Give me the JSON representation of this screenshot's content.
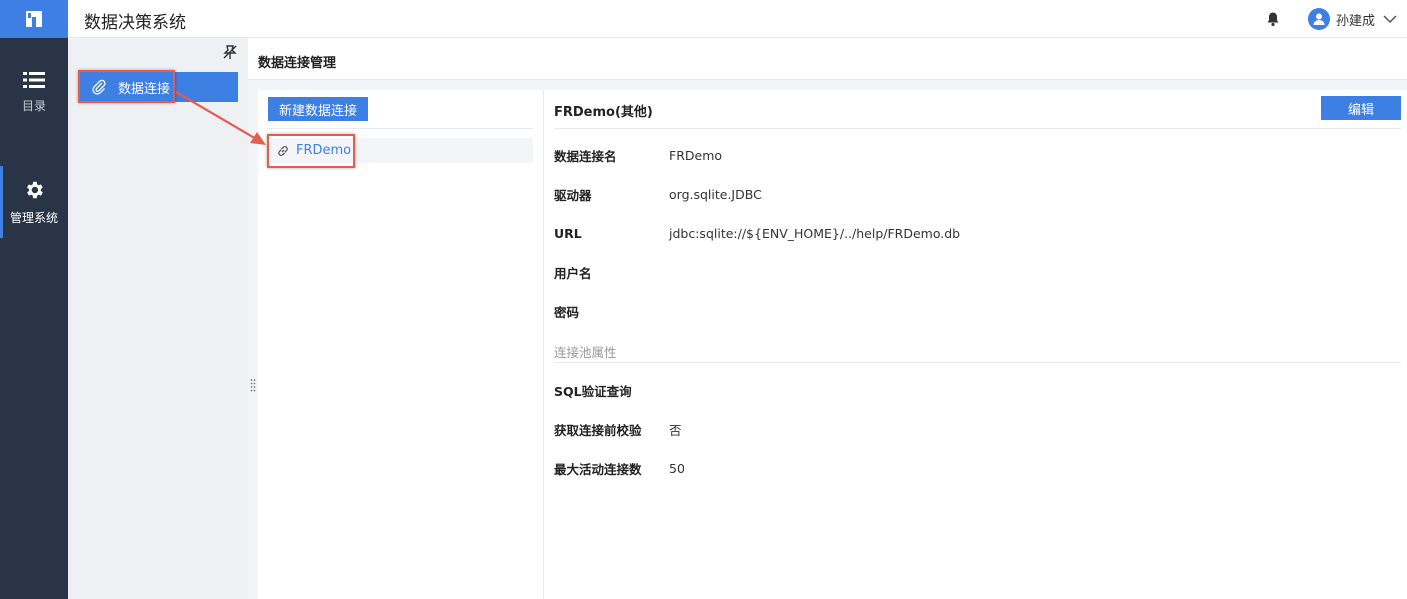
{
  "app": {
    "title": "数据决策系统"
  },
  "rail": {
    "items": [
      {
        "label": "目录",
        "icon": "list-icon",
        "active": false
      },
      {
        "label": "管理系统",
        "icon": "gear-icon",
        "active": true
      }
    ]
  },
  "header": {
    "user_name": "孙建成"
  },
  "subnav": {
    "items": [
      {
        "label": "数据连接",
        "icon": "paperclip-icon"
      }
    ]
  },
  "page": {
    "title": "数据连接管理"
  },
  "connections": {
    "new_button_label": "新建数据连接",
    "items": [
      {
        "label": "FRDemo",
        "icon": "link-icon"
      }
    ]
  },
  "detail": {
    "title": "FRDemo(其他)",
    "edit_button_label": "编辑",
    "fields": [
      {
        "key": "数据连接名",
        "value": "FRDemo"
      },
      {
        "key": "驱动器",
        "value": "org.sqlite.JDBC"
      },
      {
        "key": "URL",
        "value": "jdbc:sqlite://${ENV_HOME}/../help/FRDemo.db"
      },
      {
        "key": "用户名",
        "value": ""
      },
      {
        "key": "密码",
        "value": ""
      }
    ],
    "pool_section_label": "连接池属性",
    "pool_fields": [
      {
        "key": "SQL验证查询",
        "value": ""
      },
      {
        "key": "获取连接前校验",
        "value": "否"
      },
      {
        "key": "最大活动连接数",
        "value": "50"
      }
    ]
  },
  "colors": {
    "accent": "#3d7fe3",
    "rail": "#293546",
    "annotation": "#e45d4f"
  }
}
